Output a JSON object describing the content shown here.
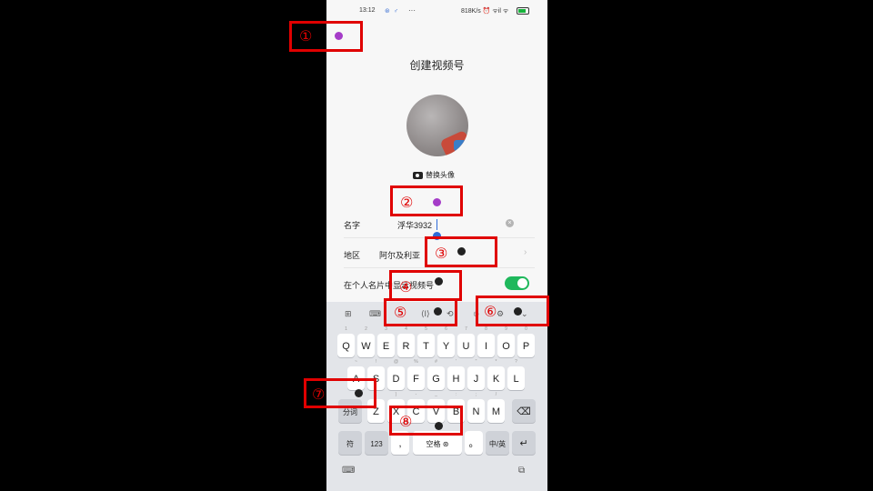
{
  "status_bar": {
    "time": "13:12",
    "app_icons": "⊛ ♂",
    "more": "···",
    "network": "818K/s ⏰ ᯤil ᯤ",
    "battery_icon": "battery-icon"
  },
  "title": "创建视频号",
  "avatar": {
    "replace_label": "替换头像",
    "icon": "camera-icon"
  },
  "form": {
    "name": {
      "label": "名字",
      "value": "浮华3932"
    },
    "region": {
      "label": "阿尔及利亚",
      "field_label": "地区"
    },
    "show_on_card": {
      "label": "在个人名片中显示视频号",
      "enabled": true
    }
  },
  "keyboard": {
    "toolbar": [
      "⊞",
      "⌨",
      "⟨I⟩",
      "⟲",
      "☺",
      "⚙",
      "⌄"
    ],
    "row1": [
      {
        "k": "Q",
        "n": "1"
      },
      {
        "k": "W",
        "n": "2"
      },
      {
        "k": "E",
        "n": "3"
      },
      {
        "k": "R",
        "n": "4"
      },
      {
        "k": "T",
        "n": "5"
      },
      {
        "k": "Y",
        "n": "6"
      },
      {
        "k": "U",
        "n": "7"
      },
      {
        "k": "I",
        "n": "8"
      },
      {
        "k": "O",
        "n": "9"
      },
      {
        "k": "P",
        "n": "0"
      }
    ],
    "row2": [
      {
        "k": "A",
        "n": "~"
      },
      {
        "k": "S",
        "n": "!"
      },
      {
        "k": "D",
        "n": "@"
      },
      {
        "k": "F",
        "n": "%"
      },
      {
        "k": "G",
        "n": "#"
      },
      {
        "k": "H",
        "n": "'"
      },
      {
        "k": "J",
        "n": "\""
      },
      {
        "k": "K",
        "n": "*"
      },
      {
        "k": "L",
        "n": "?"
      }
    ],
    "row3": [
      {
        "k": "Z",
        "n": "("
      },
      {
        "k": "X",
        "n": ")"
      },
      {
        "k": "C",
        "n": "-"
      },
      {
        "k": "V",
        "n": "_"
      },
      {
        "k": "B",
        "n": ":"
      },
      {
        "k": "N",
        "n": ";"
      },
      {
        "k": "M",
        "n": "/"
      }
    ],
    "shift_label": "分词",
    "delete_icon": "backspace-icon",
    "symbol_key": "符",
    "num_key": "123",
    "comma_key": ",",
    "space_key": "空格 ⊛",
    "period_key": "。",
    "lang_key": "中/英",
    "enter_icon": "enter-icon"
  },
  "overlays": [
    {
      "label": "①",
      "dot_color": "#a53cc8"
    },
    {
      "label": "②",
      "dot_color": "#a53cc8"
    },
    {
      "label": "③",
      "dot_color": "#222222"
    },
    {
      "label": "④",
      "dot_color": "#222222"
    },
    {
      "label": "⑤",
      "dot_color": "#222222"
    },
    {
      "label": "⑥",
      "dot_color": "#222222"
    },
    {
      "label": "⑦",
      "dot_color": "#222222"
    },
    {
      "label": "⑧",
      "dot_color": "#222222"
    }
  ]
}
